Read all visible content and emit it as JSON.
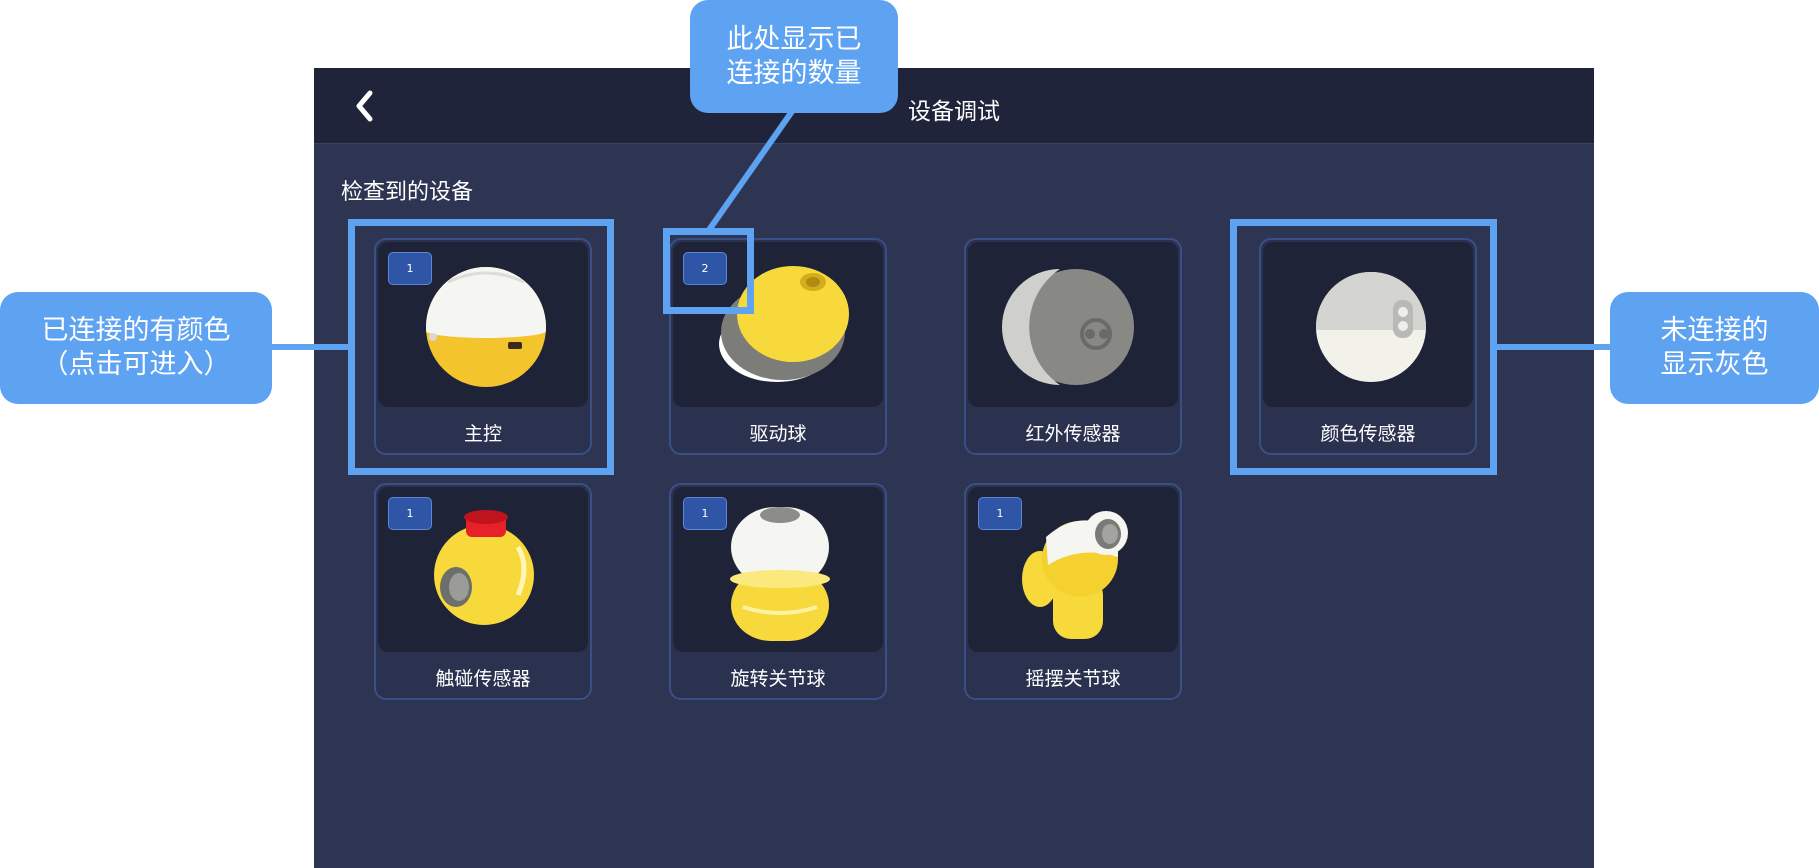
{
  "header": {
    "title": "设备调试",
    "back_icon": "chevron-left-icon"
  },
  "section_title": "检查到的设备",
  "devices": [
    {
      "label": "主控",
      "count": "1",
      "connected": true,
      "icon": "main-controller-ball-icon"
    },
    {
      "label": "驱动球",
      "count": "2",
      "connected": true,
      "icon": "drive-ball-icon"
    },
    {
      "label": "红外传感器",
      "count": "",
      "connected": false,
      "icon": "infrared-sensor-ball-icon"
    },
    {
      "label": "颜色传感器",
      "count": "",
      "connected": false,
      "icon": "color-sensor-ball-icon"
    },
    {
      "label": "触碰传感器",
      "count": "1",
      "connected": true,
      "icon": "touch-sensor-ball-icon"
    },
    {
      "label": "旋转关节球",
      "count": "1",
      "connected": true,
      "icon": "rotate-joint-ball-icon"
    },
    {
      "label": "摇摆关节球",
      "count": "1",
      "connected": true,
      "icon": "swing-joint-ball-icon"
    }
  ],
  "annotations": {
    "count_note": {
      "line1": "此处显示已",
      "line2": "连接的数量"
    },
    "connected_note": {
      "line1": "已连接的有颜色",
      "line2": "（点击可进入）"
    },
    "disconnected_note": {
      "line1": "未连接的",
      "line2": "显示灰色"
    }
  },
  "colors": {
    "app_bg": "#2e3553",
    "topbar_bg": "#20243a",
    "card_border": "#3a4f86",
    "badge_bg": "#2f56a6",
    "annotation_blue": "#5ea2f2",
    "yellow": "#f5d12f"
  }
}
